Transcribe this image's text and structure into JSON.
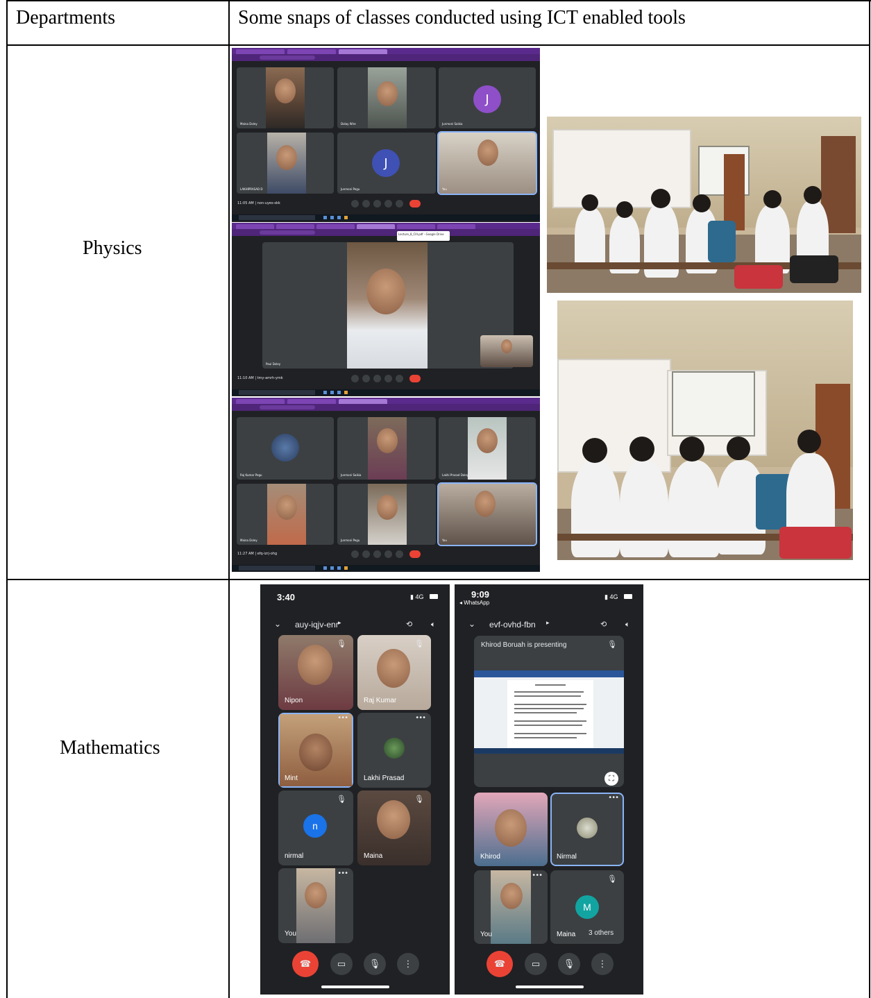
{
  "table": {
    "header": {
      "col1": "Departments",
      "col2": "Some snaps of classes conducted using ICT enabled tools"
    },
    "rows": [
      {
        "department": "Physics"
      },
      {
        "department": "Mathematics"
      }
    ]
  },
  "physics": {
    "meet1": {
      "time_code": "11:05 AM | non-uyes-skk",
      "tiles": [
        "Maina Doley",
        "Dolay Wire",
        "Junmoni Saikia",
        "LAKHIPRASAD D",
        "Junmoni Pegu",
        "You"
      ],
      "avatar_letters": [
        "J",
        "J"
      ]
    },
    "meet2": {
      "time_code": "11:10 AM | tmy-amrh-ymk",
      "tooltip": "Lecture_8_CIII.pdf - Google Drive",
      "speaker": "Paul Doley"
    },
    "meet3": {
      "time_code": "11:27 AM | efq-izrj-ohg",
      "tiles": [
        "Raj Kumar Pegu",
        "Junmoni Saikia",
        "Lakhi Prasad Doley",
        "Maina Doley",
        "Junmoni Pegu",
        "You"
      ]
    }
  },
  "mathematics": {
    "phone1": {
      "time": "3:40",
      "network": "4G",
      "meeting_code": "auy-iqjv-enr",
      "participants": [
        {
          "name": "Nipon",
          "muted": true
        },
        {
          "name": "Raj Kumar",
          "muted": true
        },
        {
          "name": "Mint",
          "active": true
        },
        {
          "name": "Lakhi Prasad"
        },
        {
          "name": "nirmal",
          "avatar": "n",
          "avatar_color": "#1a73e8",
          "muted": true
        },
        {
          "name": "Maina",
          "muted": true
        },
        {
          "name": "You"
        }
      ]
    },
    "phone2": {
      "time": "9:09",
      "back_app": "◂ WhatsApp",
      "network": "4G",
      "meeting_code": "evf-ovhd-fbn",
      "presenting": "Khirod Boruah is presenting",
      "participants": [
        {
          "name": "Khirod"
        },
        {
          "name": "Nirmal",
          "active": true
        },
        {
          "name": "You"
        },
        {
          "name": "Maina",
          "avatar": "M",
          "avatar_color": "#12a4a1",
          "muted": true
        }
      ],
      "others": "3 others"
    }
  },
  "colors": {
    "meet_bg": "#202124",
    "tile_bg": "#3c4043",
    "end_call": "#ea4335",
    "chrome_purple": "#5a2a8c"
  }
}
